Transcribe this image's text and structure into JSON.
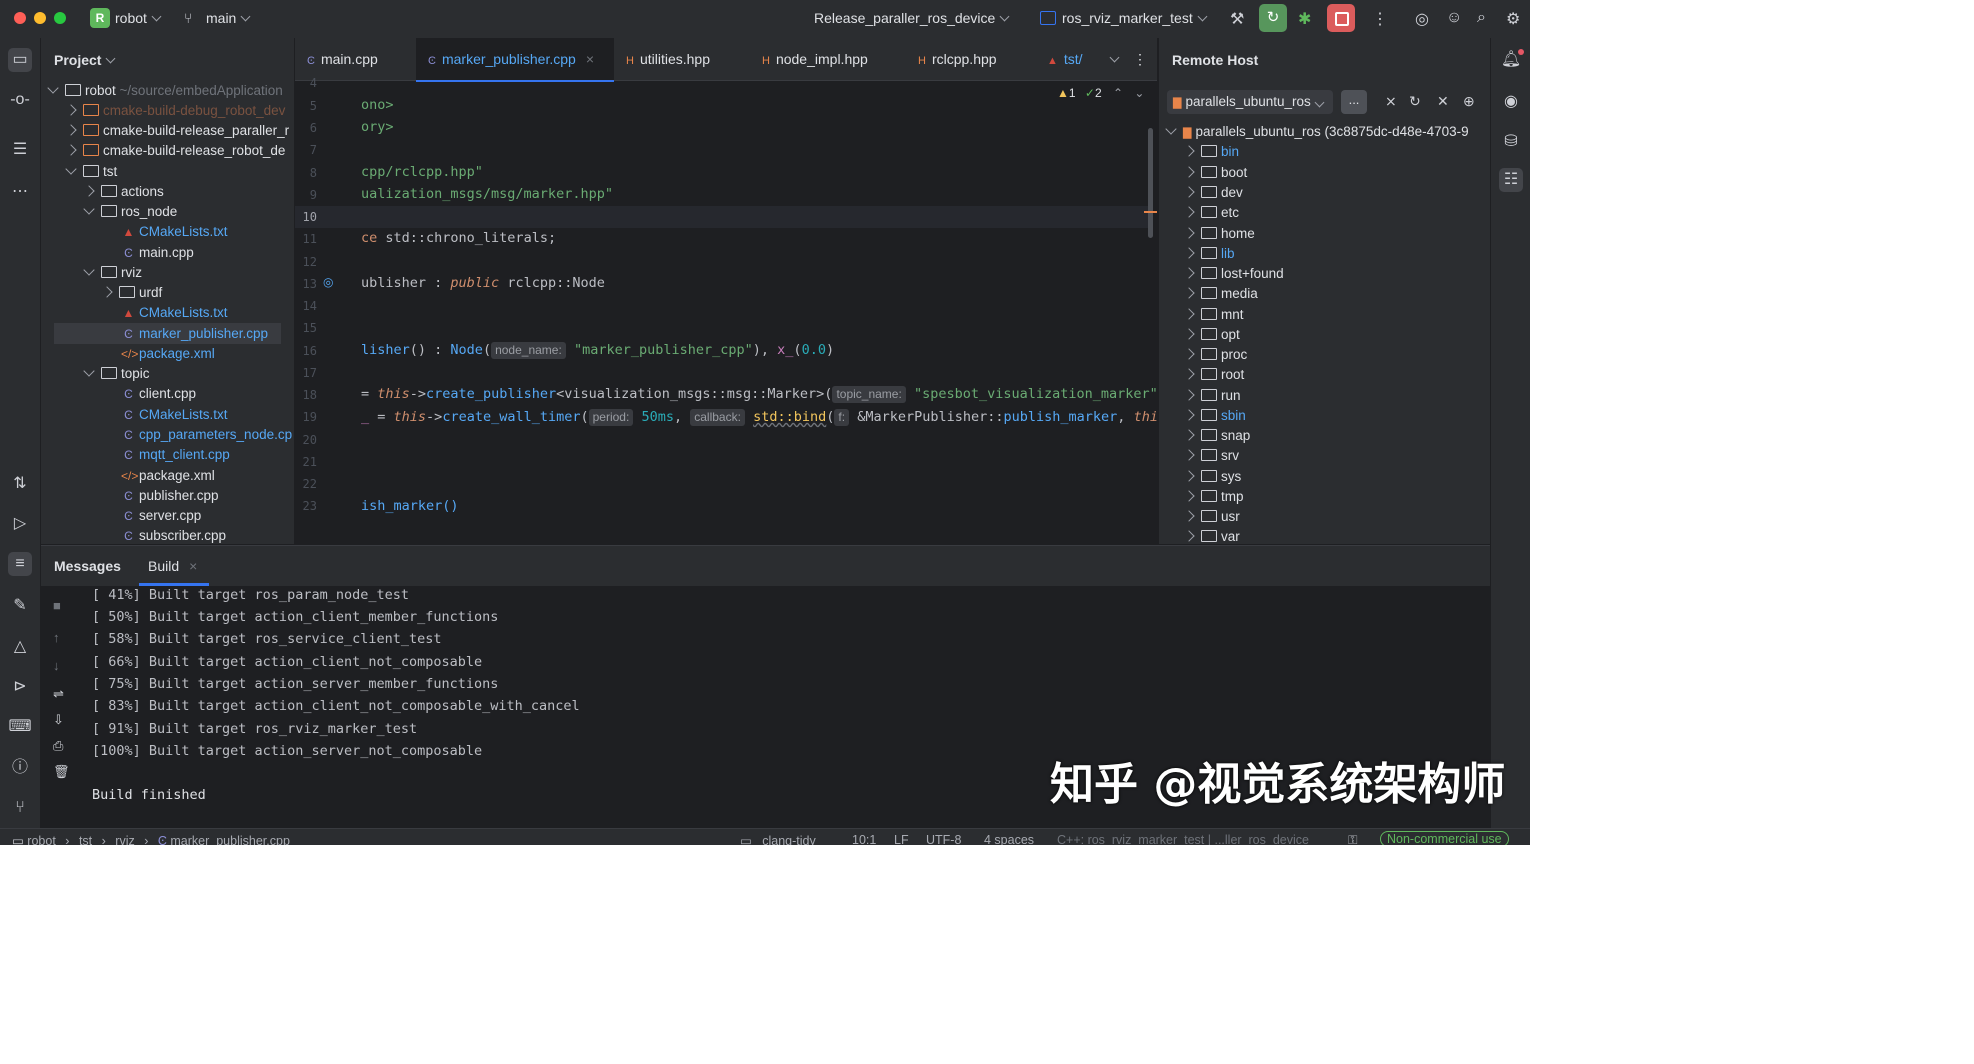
{
  "titlebar": {
    "project_badge": "R",
    "project_name": "robot",
    "branch": "main",
    "config": "Release_paraller_ros_device",
    "run_target": "ros_rviz_marker_test"
  },
  "project_panel": {
    "title": "Project",
    "items": [
      {
        "label": "robot",
        "hint": "~/source/embedApplication",
        "type": "folder"
      },
      {
        "label": "cmake-build-debug_robot_dev",
        "type": "folder-orange"
      },
      {
        "label": "cmake-build-release_paraller_r",
        "type": "folder-orange"
      },
      {
        "label": "cmake-build-release_robot_de",
        "type": "folder-orange"
      },
      {
        "label": "tst",
        "type": "folder"
      },
      {
        "label": "actions",
        "type": "folder"
      },
      {
        "label": "ros_node",
        "type": "folder"
      },
      {
        "label": "CMakeLists.txt",
        "type": "cmake"
      },
      {
        "label": "main.cpp",
        "type": "cpp"
      },
      {
        "label": "rviz",
        "type": "folder"
      },
      {
        "label": "urdf",
        "type": "folder"
      },
      {
        "label": "CMakeLists.txt",
        "type": "cmake"
      },
      {
        "label": "marker_publisher.cpp",
        "type": "cpp"
      },
      {
        "label": "package.xml",
        "type": "xml"
      },
      {
        "label": "topic",
        "type": "folder"
      },
      {
        "label": "client.cpp",
        "type": "cpp"
      },
      {
        "label": "CMakeLists.txt",
        "type": "cmake"
      },
      {
        "label": "cpp_parameters_node.cp",
        "type": "cpp"
      },
      {
        "label": "mqtt_client.cpp",
        "type": "cpp"
      },
      {
        "label": "package.xml",
        "type": "xml"
      },
      {
        "label": "publisher.cpp",
        "type": "cpp"
      },
      {
        "label": "server.cpp",
        "type": "cpp"
      },
      {
        "label": "subscriber.cpp",
        "type": "cpp"
      }
    ]
  },
  "editor": {
    "tabs": [
      "main.cpp",
      "marker_publisher.cpp",
      "utilities.hpp",
      "node_impl.hpp",
      "rclcpp.hpp",
      "tst/"
    ],
    "inspection_warnings": "1",
    "inspection_ok": "2",
    "line_numbers": [
      "4",
      "5",
      "6",
      "7",
      "8",
      "9",
      "10",
      "11",
      "12",
      "13",
      "14",
      "15",
      "16",
      "17",
      "18",
      "19",
      "20",
      "21",
      "22",
      "23"
    ],
    "lines": {
      "l5": "ono>",
      "l6": "ory>",
      "l8": "cpp/rclcpp.hpp\"",
      "l9": "ualization_msgs/msg/marker.hpp\"",
      "l11a": "ce",
      "l11b": " std::chrono_literals;",
      "l13a": "ublisher",
      "l13b": " : ",
      "l13c": "public",
      "l13d": " rclcpp::Node",
      "l16a": "lisher",
      "l16b": "() : ",
      "l16c": "Node",
      "l16d": "(",
      "l16hint": "node_name:",
      "l16e": "\"marker_publisher_cpp\"",
      "l16f": "), ",
      "l16g": "x_",
      "l16h": "(",
      "l16i": "0.0",
      "l16j": ")",
      "l18a": "= ",
      "l18b": "this",
      "l18c": "->",
      "l18d": "create_publisher",
      "l18e": "<visualization_msgs::msg::Marker>(",
      "l18hint": "topic_name:",
      "l18f": "\"spesbot_visualization_marker\",",
      "l19a": "_",
      "l19b": " = ",
      "l19c": "this",
      "l19d": "->",
      "l19e": "create_wall_timer",
      "l19f": "(",
      "l19hint1": "period:",
      "l19g": "50ms",
      "l19h": ", ",
      "l19hint2": "callback:",
      "l19i": "std::bind",
      "l19j": "(",
      "l19hint3": "f:",
      "l19k": "&MarkerPublisher::",
      "l19l": "publish_marker",
      "l19m": ", ",
      "l19n": "this",
      "l19o": ")",
      "l23": "ish_marker()"
    }
  },
  "remote_host": {
    "title": "Remote Host",
    "selector": "parallels_ubuntu_ros",
    "more_label": "...",
    "root": "parallels_ubuntu_ros (3c8875dc-d48e-4703-9",
    "dirs": [
      "bin",
      "boot",
      "dev",
      "etc",
      "home",
      "lib",
      "lost+found",
      "media",
      "mnt",
      "opt",
      "proc",
      "root",
      "run",
      "sbin",
      "snap",
      "srv",
      "sys",
      "tmp",
      "usr",
      "var"
    ]
  },
  "bottom_panel": {
    "tabs": [
      "Messages",
      "Build"
    ],
    "output": [
      "[ 41%] Built target ros_param_node_test",
      "[ 50%] Built target action_client_member_functions",
      "[ 58%] Built target ros_service_client_test",
      "[ 66%] Built target action_client_not_composable",
      "[ 75%] Built target action_server_member_functions",
      "[ 83%] Built target action_client_not_composable_with_cancel",
      "[ 91%] Built target ros_rviz_marker_test",
      "[100%] Built target action_server_not_composable",
      "",
      "Build finished"
    ]
  },
  "statusbar": {
    "breadcrumb": [
      "robot",
      "tst",
      "rviz",
      "marker_publisher.cpp"
    ],
    "clang_tidy": "clang-tidy",
    "position": "10:1",
    "line_ending": "LF",
    "encoding": "UTF-8",
    "indent": "4 spaces",
    "context": "C++: ros_rviz_marker_test | ...ller_ros_device",
    "license": "Non-commercial use"
  },
  "watermark": "知乎 @视觉系统架构师",
  "colors": {
    "accent": "#3574f0",
    "keyword": "#cf8e6d",
    "string": "#6aab73",
    "function": "#56a8f5",
    "number": "#2aacb8",
    "member": "#c77dbb",
    "class": "#bcbec4"
  }
}
